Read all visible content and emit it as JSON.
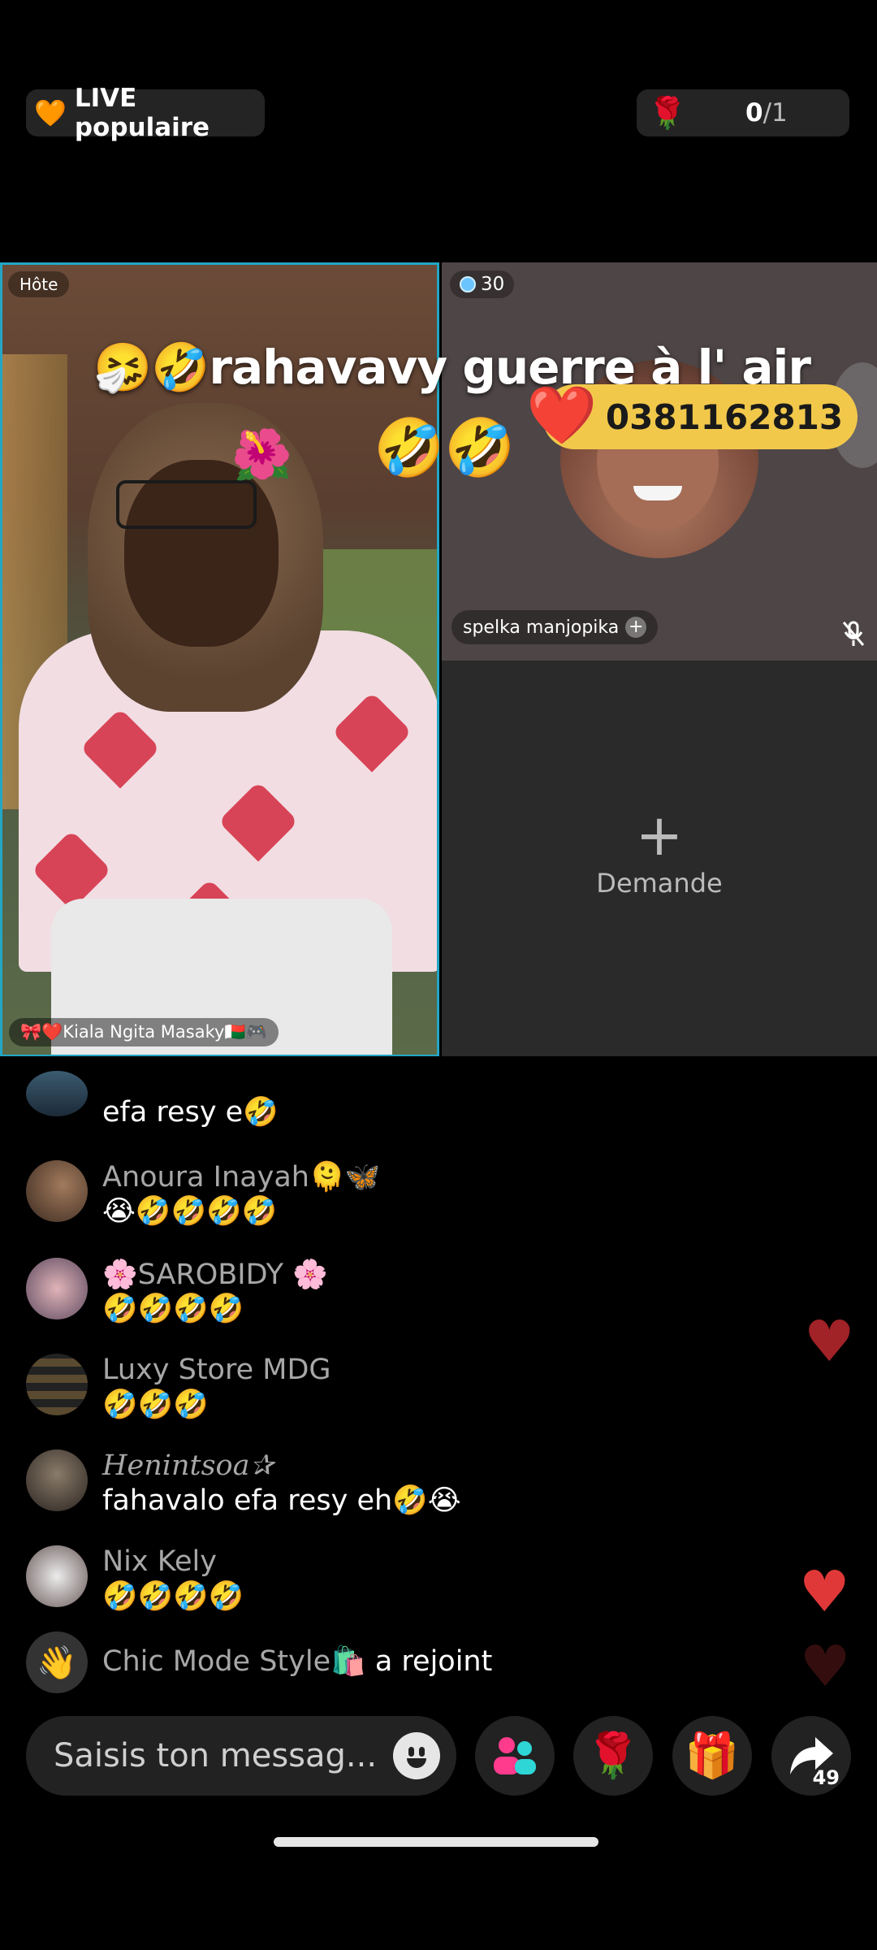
{
  "top": {
    "live_label": "LIVE populaire",
    "goal_current": "0",
    "goal_total": "/1"
  },
  "host": {
    "badge": "Hôte",
    "name": "🎀❤️Kiala Ngita Masaky🇲🇬🎮"
  },
  "guest": {
    "score": "30",
    "name": "spelka manjopika"
  },
  "request": {
    "plus": "+",
    "label": "Demande"
  },
  "banner": {
    "title": "🤧🤣rahavavy guerre à l' air",
    "emoji": "🤣🤣",
    "phone": "0381162813"
  },
  "comments": [
    {
      "name": "",
      "msg": "efa resy e🤣"
    },
    {
      "name": "Anoura Inayah🫠🦋",
      "msg": "😭🤣🤣🤣🤣"
    },
    {
      "name": "🌸SAROBIDY 🌸",
      "msg": "🤣🤣🤣🤣"
    },
    {
      "name": "Luxy Store MDG",
      "msg": "🤣🤣🤣"
    },
    {
      "name": "Henintsoa✰",
      "msg": "fahavalo efa resy eh🤣😭"
    },
    {
      "name": "Nix Kely",
      "msg": "🤣🤣🤣🤣"
    }
  ],
  "join": {
    "name": "Chic Mode Style🛍️",
    "action": "a rejoint"
  },
  "bottom": {
    "placeholder": "Saisis ton messag...",
    "share_count": "49"
  },
  "colors": {
    "host_border": "#23a6c4",
    "phone_pill": "#f2c84b",
    "heart": "#d84457"
  }
}
